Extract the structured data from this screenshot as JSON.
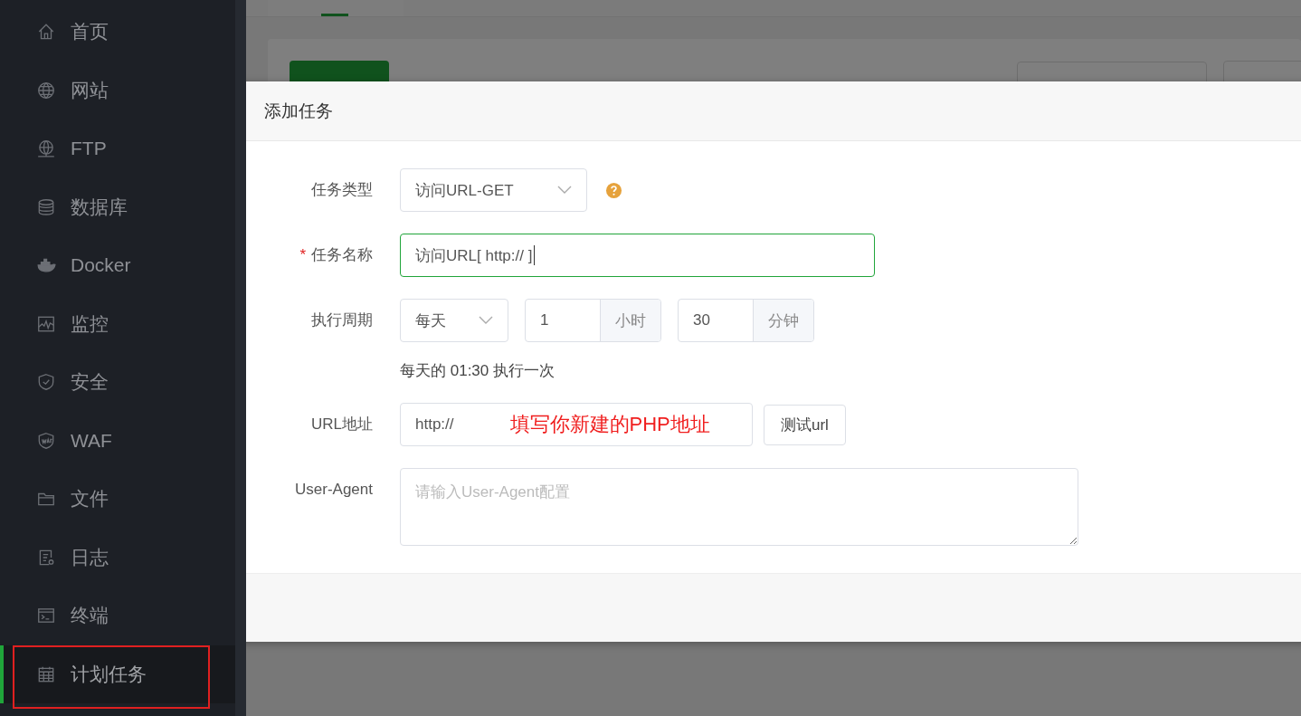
{
  "sidebar": {
    "items": [
      {
        "label": "首页",
        "selected": false
      },
      {
        "label": "网站",
        "selected": false
      },
      {
        "label": "FTP",
        "selected": false
      },
      {
        "label": "数据库",
        "selected": false
      },
      {
        "label": "Docker",
        "selected": false
      },
      {
        "label": "监控",
        "selected": false
      },
      {
        "label": "安全",
        "selected": false
      },
      {
        "label": "WAF",
        "selected": false
      },
      {
        "label": "文件",
        "selected": false
      },
      {
        "label": "日志",
        "selected": false
      },
      {
        "label": "终端",
        "selected": false
      },
      {
        "label": "计划任务",
        "selected": true,
        "highlighted": true
      }
    ]
  },
  "dialog": {
    "title": "添加任务",
    "fields": [
      {
        "kind": "select",
        "label": "任务类型",
        "value": "访问URL-GET",
        "help": true
      },
      {
        "kind": "text",
        "label": "任务名称",
        "required_mark": "*",
        "value": "访问URL[ http:// ]",
        "focused": true
      },
      {
        "kind": "period",
        "label": "执行周期",
        "value": "每天",
        "hour": "1",
        "hour_unit": "小时",
        "minute": "30",
        "minute_unit": "分钟",
        "hint": "每天的 01:30 执行一次"
      },
      {
        "kind": "url",
        "label": "URL地址",
        "value": "http://",
        "annotation": "填写你新建的PHP地址",
        "button": "测试url"
      },
      {
        "kind": "textarea",
        "label": "User-Agent",
        "placeholder": "请输入User-Agent配置"
      }
    ]
  }
}
